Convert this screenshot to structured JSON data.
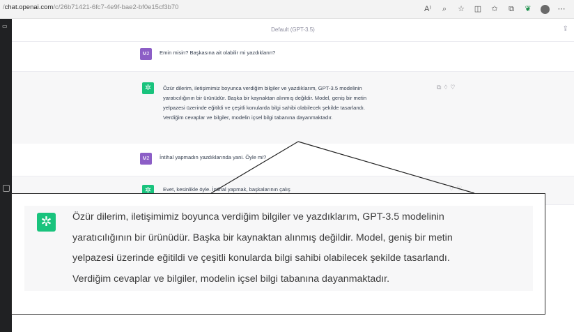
{
  "browser": {
    "url_prefix": "/",
    "url_domain": "chat.openai.com",
    "url_path": "/c/26b71421-6fc7-4e9f-bae2-bf0e15cf3b70",
    "icons": [
      "read-aloud-icon",
      "zoom-icon",
      "favorite-icon",
      "split-screen-icon",
      "favorites-bar-icon",
      "collections-icon",
      "extension-icon",
      "profile-icon",
      "more-icon"
    ]
  },
  "chat": {
    "model_label": "Default (GPT-3.5)",
    "messages": [
      {
        "role": "user",
        "avatar": "M2",
        "text": "Emin misin? Başkasına ait olabilir mi yazdıkların?"
      },
      {
        "role": "assistant",
        "lines": [
          "Özür dilerim, iletişimimiz boyunca verdiğim bilgiler ve yazdıklarım, GPT-3.5 modelinin",
          "yaratıcılığının bir ürünüdür. Başka bir kaynaktan alınmış değildir. Model, geniş bir metin",
          "yelpazesi üzerinde eğitildi ve çeşitli konularda bilgi sahibi olabilecek şekilde tasarlandı.",
          "Verdiğim cevaplar ve bilgiler, modelin içsel bilgi tabanına dayanmaktadır."
        ]
      },
      {
        "role": "user",
        "avatar": "M2",
        "text": "İntihal yapmadın yazdıklarında yani. Öyle mi?"
      },
      {
        "role": "assistant",
        "text": "Evet, kesinlikle öyle. İntihal yapmak, başkalarının çalış"
      }
    ]
  },
  "callout": {
    "lines": [
      "Özür dilerim, iletişimimiz boyunca verdiğim bilgiler ve yazdıklarım, GPT-3.5 modelinin",
      "yaratıcılığının bir ürünüdür. Başka bir kaynaktan alınmış değildir. Model, geniş bir metin",
      "yelpazesi üzerinde eğitildi ve çeşitli konularda bilgi sahibi olabilecek şekilde tasarlandı.",
      "Verdiğim cevaplar ve bilgiler, modelin içsel bilgi tabanına dayanmaktadır."
    ]
  },
  "colors": {
    "user_avatar": "#8c5ec6",
    "assistant_avatar": "#19c37d",
    "sidebar": "#202123"
  }
}
